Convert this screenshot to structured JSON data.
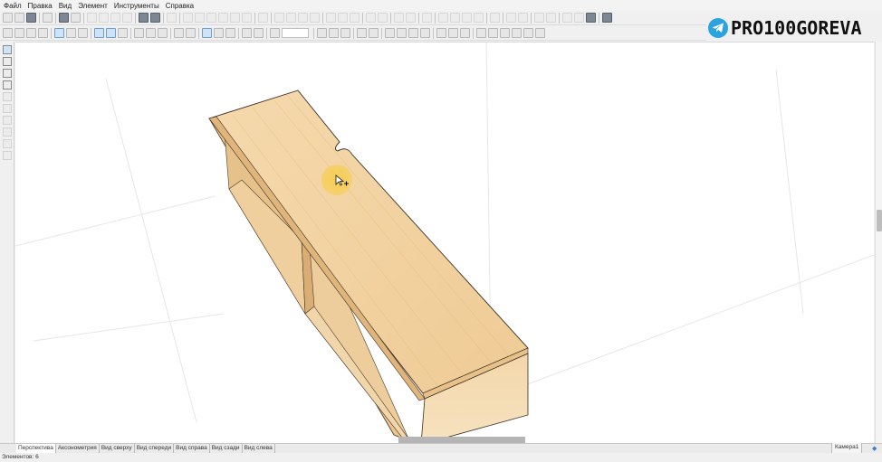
{
  "menu": {
    "items": [
      "Файл",
      "Правка",
      "Вид",
      "Элемент",
      "Инструменты",
      "Справка"
    ]
  },
  "toolbar1": {
    "icons": [
      "new-icon",
      "open-icon",
      "save-icon",
      "sep",
      "export-icon",
      "sep",
      "print-icon",
      "print-preview-icon",
      "sep",
      "cut-icon",
      "copy-icon",
      "paste-icon",
      "delete-icon",
      "sep",
      "globe-icon",
      "sphere-icon",
      "sep",
      "library-icon",
      "sep",
      "panel-icon",
      "panel-2-icon",
      "panel-3-icon",
      "panel-4-icon",
      "panel-5-icon",
      "settings-icon",
      "sep",
      "sum-icon",
      "sep",
      "align-1-icon",
      "align-2-icon",
      "align-3-icon",
      "align-4-icon",
      "sep",
      "align-5-icon",
      "align-6-icon",
      "align-7-icon",
      "sep",
      "rotate-1-icon",
      "rotate-2-icon",
      "sep",
      "mirror-1-icon",
      "mirror-2-icon",
      "sep",
      "grid-icon",
      "sep",
      "hide-1-icon",
      "hide-2-icon",
      "arrow-up-icon",
      "arrow-down-icon",
      "sep",
      "curve-icon",
      "sep",
      "blocks-1-icon",
      "blocks-2-icon",
      "sep",
      "layer-icon",
      "shape-icon",
      "sep",
      "ellipse-icon",
      "cloud-icon",
      "eye-icon",
      "sep",
      "gear-icon"
    ],
    "faint_from": 9
  },
  "toolbar2": {
    "icons": [
      "view-persp-icon",
      "view-front-icon",
      "view-top-icon",
      "view-side-icon",
      "sep",
      "view-axo-icon",
      "view-back-icon",
      "view-right-icon",
      "sep",
      "select-icon",
      "select-2-icon",
      "light-icon",
      "sep",
      "filter-icon",
      "dimension-icon",
      "hatch-icon",
      "sep",
      "eye-2-icon",
      "move-icon",
      "sep",
      "snap-icon",
      "snap-2-icon",
      "snap-3-icon",
      "sep",
      "magnet-icon",
      "target-icon",
      "sep",
      "zoom-icon",
      "zoombox",
      "sep",
      "arrow-1-icon",
      "arrow-2-icon",
      "arrow-3-icon",
      "sep",
      "stretch-1-icon",
      "stretch-2-icon",
      "sep",
      "pos-1-icon",
      "pos-2-icon",
      "pos-3-icon",
      "pos-4-icon",
      "sep",
      "pos-5-icon",
      "pos-6-icon",
      "pos-7-icon",
      "sep",
      "pos-8-icon",
      "pos-9-icon",
      "pos-10-icon",
      "pos-11-icon",
      "pos-12-icon",
      "pos-13-icon"
    ],
    "active": [
      4,
      5,
      9,
      10,
      19,
      20
    ]
  },
  "brand": {
    "text": "PRO100GOREVA",
    "icon": "telegram-icon",
    "icon_color": "#2aa3df"
  },
  "left_tools": [
    "pointer-icon",
    "rotate-view-icon",
    "pan-icon",
    "eyedropper-icon",
    "copy-tool-icon",
    "tool-6-icon",
    "tool-7-icon",
    "tool-8-icon",
    "tool-9-icon",
    "tool-10-icon"
  ],
  "model": {
    "object": "cabinet",
    "wood_color": "#f3d3a3",
    "highlight_color": "#f9d04f"
  },
  "tabs": [
    "Перспектива",
    "Аксонометрия",
    "Вид сверху",
    "Вид спереди",
    "Вид справа",
    "Вид сзади",
    "Вид слева"
  ],
  "camera_tab": "Камера1",
  "status": {
    "text": "Элементов: 6"
  }
}
